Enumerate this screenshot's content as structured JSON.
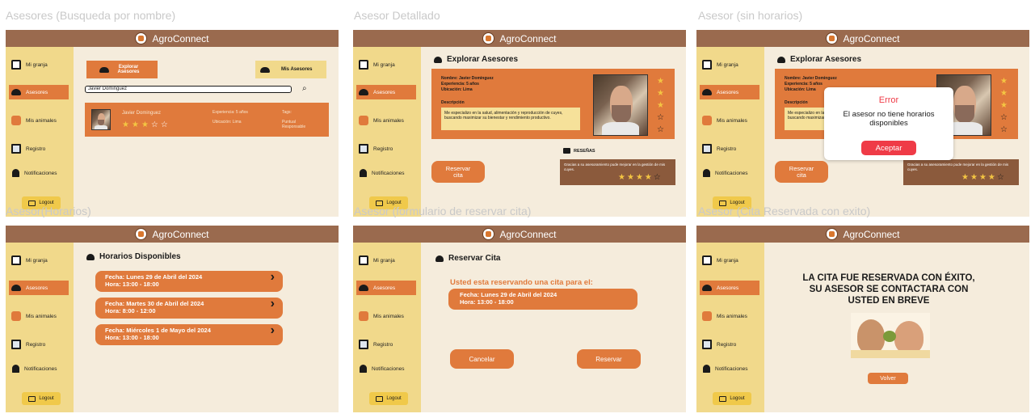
{
  "app_title": "AgroConnect",
  "frame_labels": {
    "f1": "Asesores (Busqueda por nombre)",
    "f2": "Asesor Detallado",
    "f3": "Asesor (sin horarios)",
    "f4": "Asesor(Horarios)",
    "f5": "Asesor (formulario de reservar cita)",
    "f6": "Asesor (Cita Reservada con exito)"
  },
  "sidebar": {
    "items": [
      "Mi granja",
      "Asesores",
      "Mis animales",
      "Registro",
      "Notificaciones"
    ],
    "logout": "Logout"
  },
  "search_screen": {
    "explore_button": "Explorar Asesores",
    "my_advisors_button": "Mis Asesores",
    "search_value": "Javier Dominguez",
    "card": {
      "name": "Javier Dominguez",
      "experience": "Experiencia: 5 años",
      "location": "Ubicación: Lima",
      "tags_label": "Tags:",
      "tags": "Puntual\nResponsable",
      "rating": 3
    }
  },
  "detail_screen": {
    "heading": "Explorar Asesores",
    "name": "Nombre: Javier Dominguez",
    "experience": "Experiencia: 5 años",
    "location": "Ubicación: Lima",
    "description_label": "Descripción",
    "description": "Me especializo en la salud, alimentación y reproducción de cuyes, buscando maximizar su bienestar y rendimiento productivo.",
    "reserve_button": "Reservar cita",
    "reviews_title": "RESEÑAS",
    "review_text": "Gracias a su asesoramiento pude mejorar en la gestión de mis cuyes.",
    "review_rating": 4,
    "vertical_rating": 3
  },
  "no_schedule_screen": {
    "name_short": "Nombre: Javier Dominguez",
    "experience_short": "Experiencia: 5 años",
    "location_short": "Ubicación: Lima",
    "description_short": "Me especializo en la s\nbuscando maximizar su",
    "review_short": "Gracias a su asesoramiento pude mejorar en la gestión de mis cuyes.",
    "modal_title": "Error",
    "modal_message": "El asesor no tiene horarios disponibles",
    "modal_button": "Aceptar"
  },
  "schedule_screen": {
    "heading": "Horarios Disponibles",
    "slots": [
      {
        "date": "Fecha: Lunes 29 de Abril del 2024",
        "time": "Hora: 13:00 - 18:00"
      },
      {
        "date": "Fecha: Martes 30 de Abril del 2024",
        "time": "Hora: 8:00 - 12:00"
      },
      {
        "date": "Fecha: Miércoles 1 de Mayo del 2024",
        "time": "Hora: 13:00 - 18:00"
      }
    ]
  },
  "reserve_form_screen": {
    "heading": "Reservar Cita",
    "intro": "Usted esta reservando una cita para el:",
    "date": "Fecha: Lunes 29 de Abril del 2024",
    "time": "Hora: 13:00 - 18:00",
    "cancel": "Cancelar",
    "reserve": "Reservar"
  },
  "success_screen": {
    "message": "LA CITA FUE RESERVADA CON ÉXITO, SU ASESOR SE CONTACTARA CON USTED EN BREVE",
    "back_button": "Volver"
  },
  "colors": {
    "brown_bar": "#9a6a4e",
    "sidebar": "#f1d98b",
    "background": "#f5ecdc",
    "orange": "#e07a3c",
    "star": "#f4c542",
    "modal_button": "#ef3b47"
  }
}
